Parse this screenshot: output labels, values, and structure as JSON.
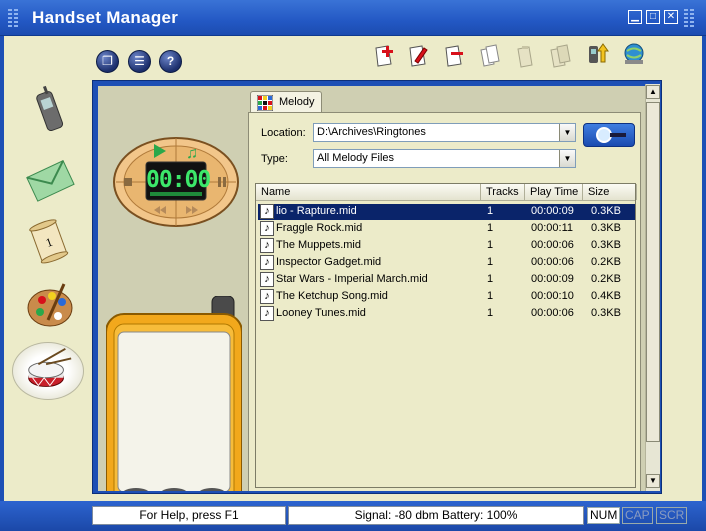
{
  "window": {
    "title": "Handset Manager",
    "controls": {
      "minimize": "▁",
      "maximize": "□",
      "close": "✕"
    }
  },
  "toolbar_left": [
    {
      "name": "new-doc-button",
      "glyph": "❐"
    },
    {
      "name": "list-view-button",
      "glyph": "☰"
    },
    {
      "name": "help-button",
      "glyph": "?"
    }
  ],
  "player": {
    "time": "00:00"
  },
  "tab": {
    "label": "Melody"
  },
  "form": {
    "location_label": "Location:",
    "location_value": "D:\\Archives\\Ringtones",
    "type_label": "Type:",
    "type_value": "All Melody Files"
  },
  "table": {
    "columns": [
      "Name",
      "Tracks",
      "Play Time",
      "Size"
    ],
    "rows": [
      {
        "name": "lio - Rapture.mid",
        "tracks": "1",
        "time": "00:00:09",
        "size": "0.3KB"
      },
      {
        "name": "Fraggle Rock.mid",
        "tracks": "1",
        "time": "00:00:11",
        "size": "0.3KB"
      },
      {
        "name": "The Muppets.mid",
        "tracks": "1",
        "time": "00:00:06",
        "size": "0.3KB"
      },
      {
        "name": "Inspector Gadget.mid",
        "tracks": "1",
        "time": "00:00:06",
        "size": "0.2KB"
      },
      {
        "name": "Star Wars - Imperial March.mid",
        "tracks": "1",
        "time": "00:00:09",
        "size": "0.2KB"
      },
      {
        "name": "The Ketchup Song.mid",
        "tracks": "1",
        "time": "00:00:10",
        "size": "0.4KB"
      },
      {
        "name": "Looney Tunes.mid",
        "tracks": "1",
        "time": "00:00:06",
        "size": "0.3KB"
      }
    ],
    "selected_index": 0
  },
  "status": {
    "help": "For Help, press F1",
    "signal": "Signal: -80 dbm Battery: 100%",
    "num": "NUM",
    "cap": "CAP",
    "scr": "SCR"
  },
  "colors": {
    "frame_blue": "#1d4fb5",
    "panel_beige": "#ecebc9",
    "selection": "#0a246a",
    "phone_orange": "#f0a81c"
  }
}
